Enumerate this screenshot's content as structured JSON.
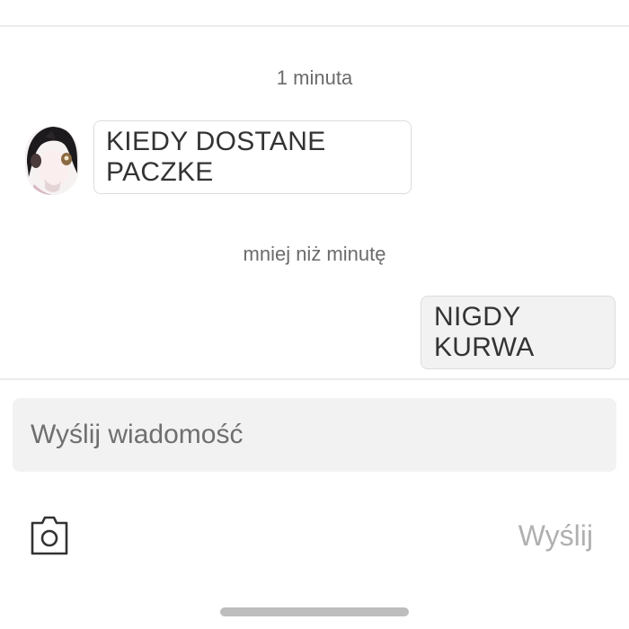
{
  "conversation": {
    "timestamp_first": "1 minuta",
    "incoming_message": "KIEDY DOSTANE PACZKE",
    "timestamp_second": "mniej niż minutę",
    "outgoing_message": "NIGDY KURWA"
  },
  "composer": {
    "placeholder": "Wyślij wiadomość",
    "send_label": "Wyślij",
    "camera_icon": "camera-icon"
  },
  "colors": {
    "background": "#ffffff",
    "outgoing_bubble": "#f2f2f2",
    "composer_bg": "#f2f2f2",
    "send_disabled": "#b0b0b0"
  }
}
